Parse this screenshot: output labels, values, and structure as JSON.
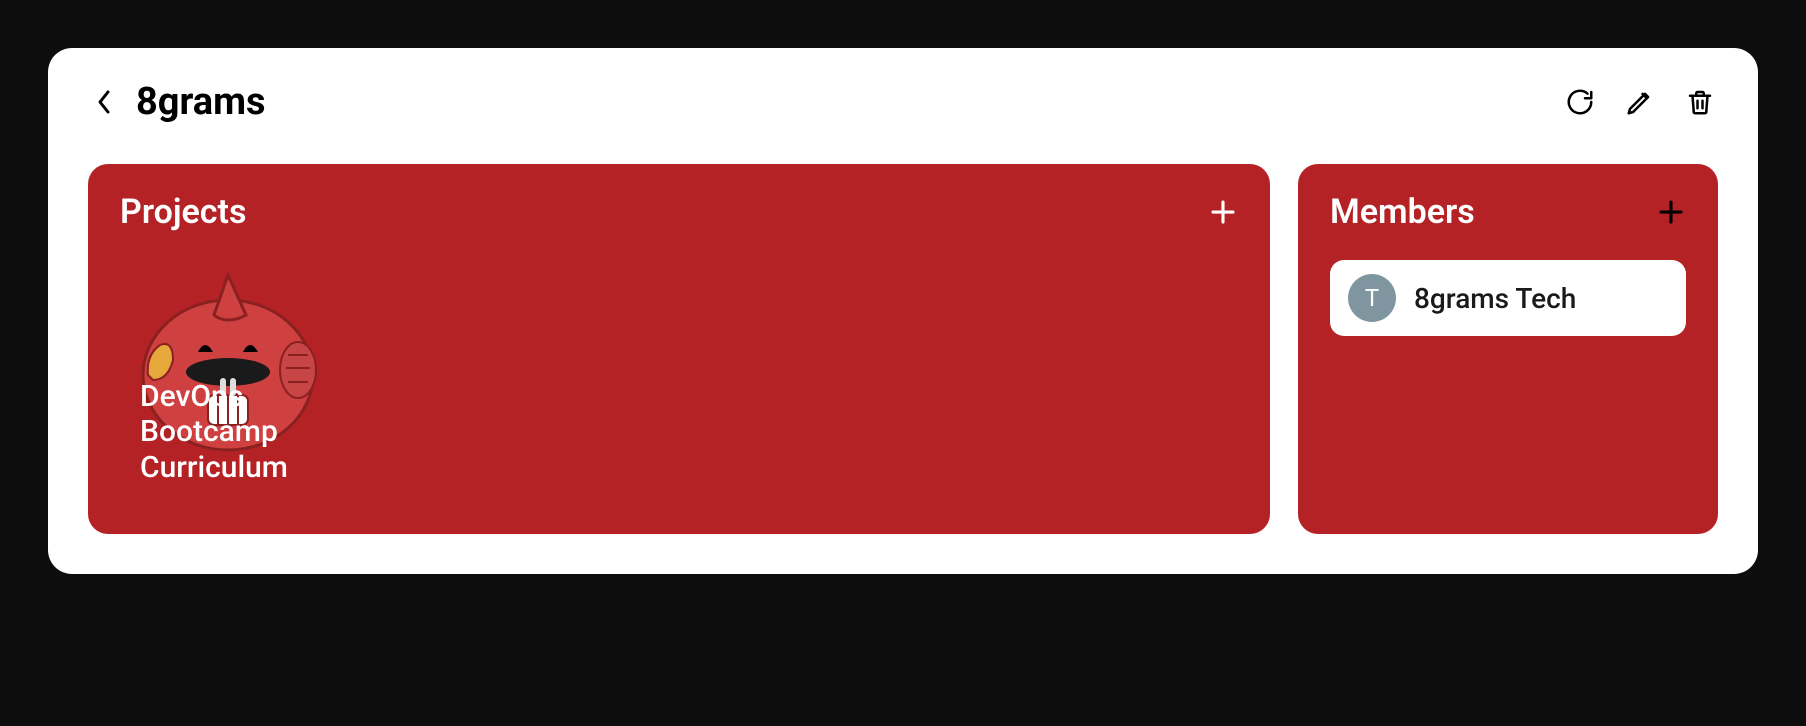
{
  "header": {
    "title": "8grams"
  },
  "projects": {
    "title": "Projects",
    "items": [
      {
        "name": "DevOps\nBootcamp\nCurriculum"
      }
    ]
  },
  "members": {
    "title": "Members",
    "items": [
      {
        "initial": "T",
        "name": "8grams Tech"
      }
    ]
  },
  "colors": {
    "panel_bg": "#b52226",
    "avatar_bg": "#7f96a0"
  }
}
